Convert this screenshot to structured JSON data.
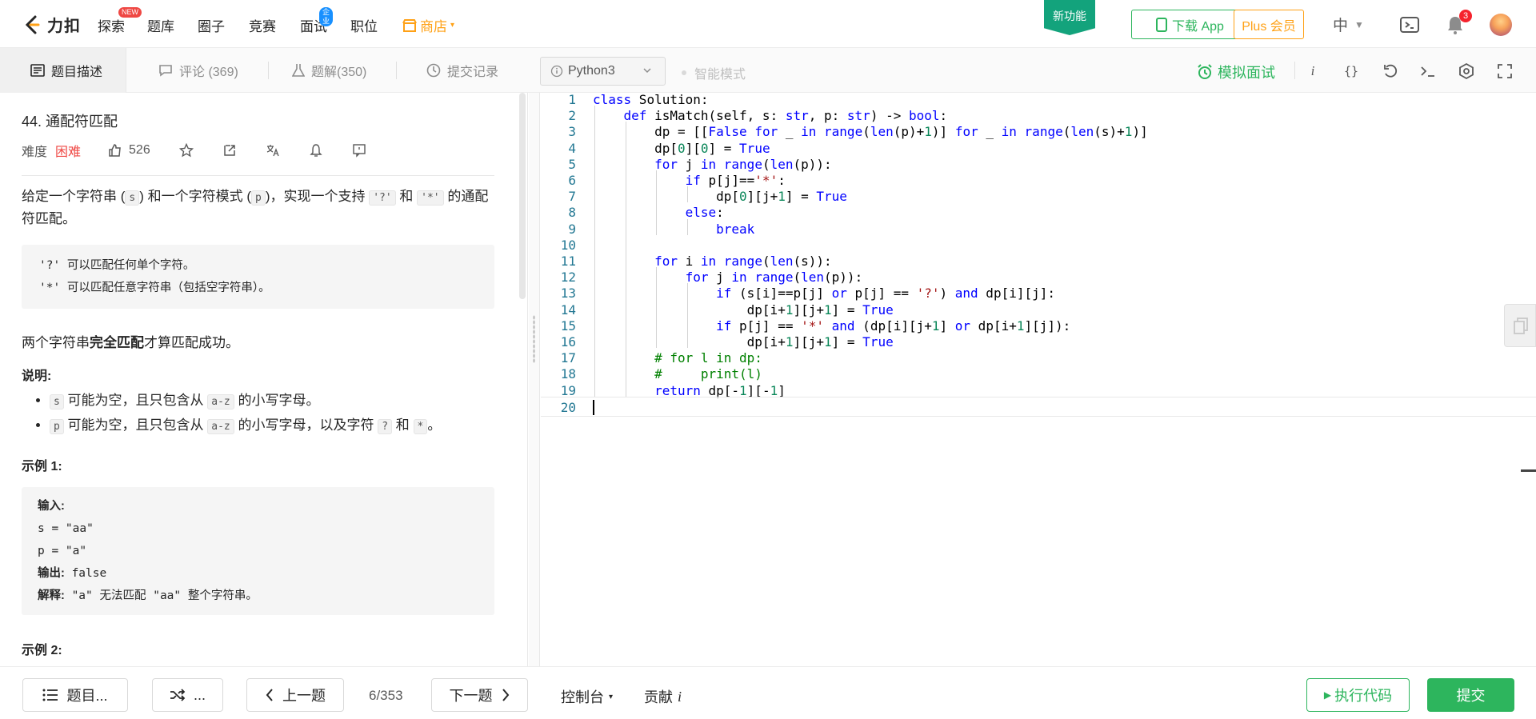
{
  "nav": {
    "logo_text": "力扣",
    "items": [
      {
        "label": "探索",
        "badge": "NEW"
      },
      {
        "label": "题库"
      },
      {
        "label": "圈子"
      },
      {
        "label": "竞赛"
      },
      {
        "label": "面试",
        "badge": "企业"
      },
      {
        "label": "职位"
      }
    ],
    "store_label": "商店",
    "new_feature": "新功能",
    "download_app": "下载 App",
    "plus": "Plus 会员",
    "lang": "中",
    "notification_count": "3",
    "colors": {
      "brand_green": "#2db55d",
      "store_orange": "#ffa116",
      "new_badge": "#ef4743",
      "enterprise_badge": "#1890ff"
    }
  },
  "toolbar": {
    "tabs": [
      {
        "label": "题目描述",
        "icon": "description-icon",
        "active": true
      },
      {
        "label": "评论 (369)",
        "icon": "comment-icon"
      },
      {
        "label": "题解(350)",
        "icon": "flask-icon"
      },
      {
        "label": "提交记录",
        "icon": "clock-icon"
      }
    ],
    "language": "Python3",
    "smart_mode": "智能模式",
    "mock_interview": "模拟面试",
    "tool_icons": [
      "info-icon",
      "braces-icon",
      "reset-icon",
      "terminal-icon",
      "settings-icon",
      "fullscreen-icon"
    ]
  },
  "problem": {
    "title": "44. 通配符匹配",
    "difficulty_label": "难度",
    "difficulty": "困难",
    "likes": "526",
    "desc_1": "给定一个字符串 (",
    "desc_s": "s",
    "desc_2": ") 和一个字符模式 (",
    "desc_p": "p",
    "desc_3": ")，实现一个支持 ",
    "desc_q": "'?'",
    "desc_and": " 和 ",
    "desc_star": "'*'",
    "desc_4": " 的通配符匹配。",
    "rules": [
      "'?' 可以匹配任何单个字符。",
      "'*' 可以匹配任意字符串（包括空字符串）。"
    ],
    "match_pre": "两个字符串",
    "match_bold": "完全匹配",
    "match_post": "才算匹配成功。",
    "notes_heading": "说明:",
    "note1": {
      "var": "s",
      "text1": " 可能为空，且只包含从 ",
      "range": "a-z",
      "text2": " 的小写字母。"
    },
    "note2": {
      "var": "p",
      "text1": " 可能为空，且只包含从 ",
      "range": "a-z",
      "text2": " 的小写字母，以及字符 ",
      "q": "?",
      "and": " 和 ",
      "star": "*",
      "end": "。"
    },
    "example1_heading": "示例 1:",
    "example1": {
      "input_label": "输入:",
      "s_line": "s = \"aa\"",
      "p_line": "p = \"a\"",
      "output_label": "输出:",
      "output": " false",
      "explain_label": "解释:",
      "explain": " \"a\" 无法匹配 \"aa\" 整个字符串。"
    },
    "example2_heading": "示例 2:"
  },
  "editor": {
    "lines": [
      "class Solution:",
      "    def isMatch(self, s: str, p: str) -> bool:",
      "        dp = [[False for _ in range(len(p)+1)] for _ in range(len(s)+1)]",
      "        dp[0][0] = True",
      "        for j in range(len(p)):",
      "            if p[j]=='*':",
      "                dp[0][j+1] = True",
      "            else:",
      "                break",
      "",
      "        for i in range(len(s)):",
      "            for j in range(len(p)):",
      "                if (s[i]==p[j] or p[j] == '?') and dp[i][j]:",
      "                    dp[i+1][j+1] = True",
      "                if p[j] == '*' and (dp[i][j+1] or dp[i+1][j]):",
      "                    dp[i+1][j+1] = True",
      "        # for l in dp:",
      "        #     print(l)",
      "        return dp[-1][-1]",
      ""
    ],
    "current_line": 20
  },
  "bottom": {
    "problem_list": "题目...",
    "random": "...",
    "prev": "上一题",
    "pager": "6/353",
    "next": "下一题",
    "console": "控制台",
    "contribute": "贡献",
    "contribute_icon": "i",
    "run": "执行代码",
    "submit": "提交"
  }
}
